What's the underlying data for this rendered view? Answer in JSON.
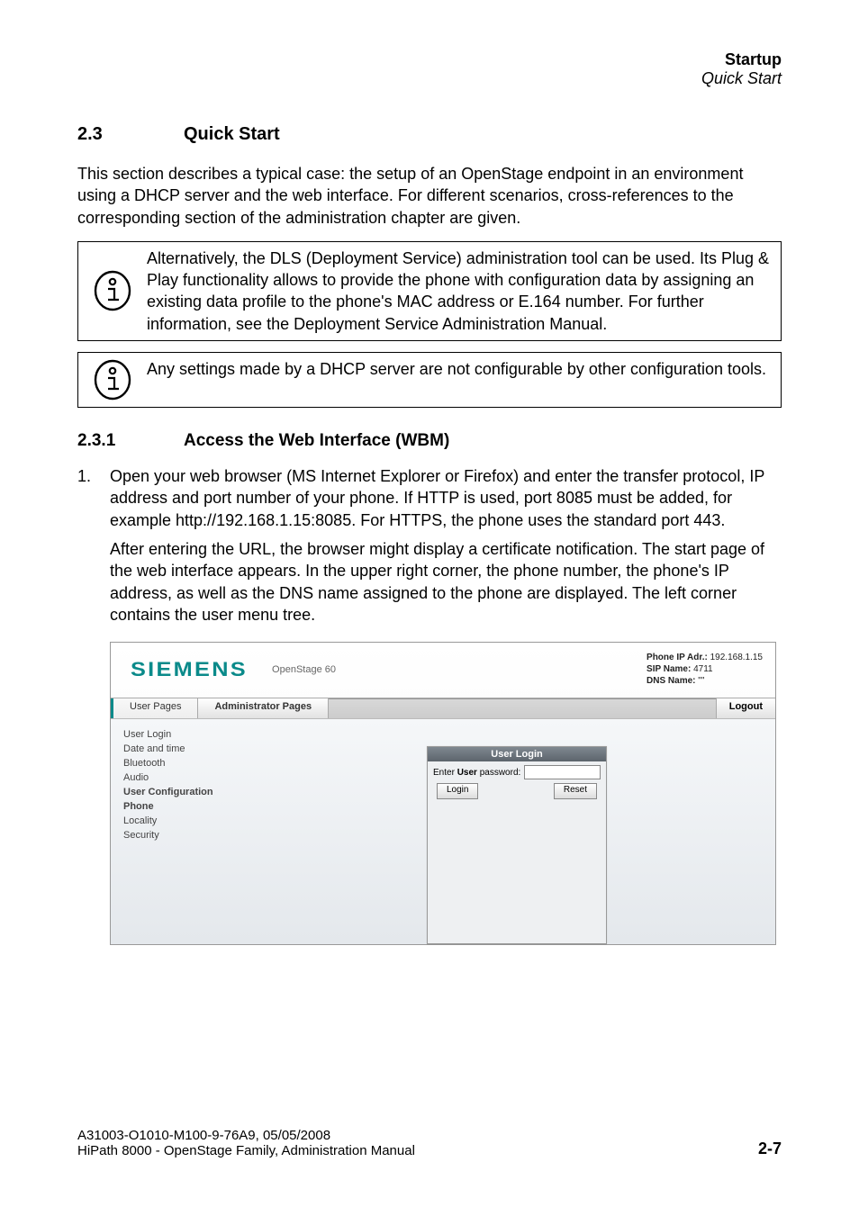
{
  "header": {
    "chapter": "Startup",
    "section": "Quick Start"
  },
  "h2": {
    "num": "2.3",
    "title": "Quick Start"
  },
  "intro": "This section describes a typical case: the setup of an OpenStage endpoint in an environment using a DHCP server and the web interface. For different scenarios, cross-references to the corresponding section of the administration chapter are given.",
  "note1": "Alternatively, the DLS (Deployment Service) administration tool can be used. Its Plug & Play functionality allows to provide the phone with configuration data by assigning an existing data profile to the phone's MAC address or E.164 number. For further information, see the Deployment Service Administration Manual.",
  "note2": "Any settings made by a DHCP server are not configurable by other configuration tools.",
  "h3": {
    "num": "2.3.1",
    "title": "Access the Web Interface (WBM)"
  },
  "step1_marker": "1.",
  "step1_p1": "Open your web browser (MS Internet Explorer or Firefox) and enter the transfer protocol, IP address and port number of your phone. If HTTP is used, port 8085 must be added, for example http://192.168.1.15:8085. For HTTPS, the phone uses the standard port 443.",
  "step1_p2": "After entering the URL, the browser might display a certificate notification. The start page of the web interface appears. In the upper right corner, the phone number, the phone's IP address, as well as the DNS name assigned to the phone are displayed. The left corner contains the user menu tree.",
  "wbm": {
    "logo": "SIEMENS",
    "model": "OpenStage 60",
    "info": {
      "ip_label": "Phone IP Adr.:",
      "ip_value": "192.168.1.15",
      "sip_label": "SIP Name:",
      "sip_value": "4711",
      "dns_label": "DNS Name:",
      "dns_value": "\"\""
    },
    "tabs": {
      "user": "User Pages",
      "admin": "Administrator Pages",
      "logout": "Logout"
    },
    "side": {
      "i0": "User Login",
      "i1": "Date and time",
      "i2": "Bluetooth",
      "i3": "Audio",
      "i4": "User Configuration",
      "i5": "Phone",
      "i6": "Locality",
      "i7": "Security"
    },
    "panel": {
      "title": "User Login",
      "enter_prefix": "Enter ",
      "enter_bold": "User",
      "enter_suffix": " password:",
      "login_btn": "Login",
      "reset_btn": "Reset"
    }
  },
  "footer": {
    "line1": "A31003-O1010-M100-9-76A9, 05/05/2008",
    "line2": "HiPath 8000 - OpenStage Family, Administration Manual",
    "page": "2-7"
  }
}
